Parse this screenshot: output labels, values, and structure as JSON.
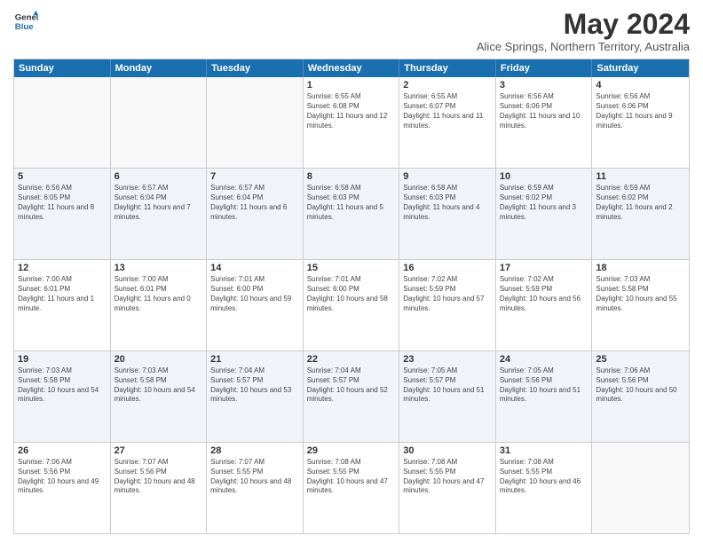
{
  "header": {
    "logo_line1": "General",
    "logo_line2": "Blue",
    "main_title": "May 2024",
    "sub_title": "Alice Springs, Northern Territory, Australia"
  },
  "days_of_week": [
    "Sunday",
    "Monday",
    "Tuesday",
    "Wednesday",
    "Thursday",
    "Friday",
    "Saturday"
  ],
  "weeks": [
    [
      {
        "day": "",
        "text": ""
      },
      {
        "day": "",
        "text": ""
      },
      {
        "day": "",
        "text": ""
      },
      {
        "day": "1",
        "text": "Sunrise: 6:55 AM\nSunset: 6:08 PM\nDaylight: 11 hours and 12 minutes."
      },
      {
        "day": "2",
        "text": "Sunrise: 6:55 AM\nSunset: 6:07 PM\nDaylight: 11 hours and 11 minutes."
      },
      {
        "day": "3",
        "text": "Sunrise: 6:56 AM\nSunset: 6:06 PM\nDaylight: 11 hours and 10 minutes."
      },
      {
        "day": "4",
        "text": "Sunrise: 6:56 AM\nSunset: 6:06 PM\nDaylight: 11 hours and 9 minutes."
      }
    ],
    [
      {
        "day": "5",
        "text": "Sunrise: 6:56 AM\nSunset: 6:05 PM\nDaylight: 11 hours and 8 minutes."
      },
      {
        "day": "6",
        "text": "Sunrise: 6:57 AM\nSunset: 6:04 PM\nDaylight: 11 hours and 7 minutes."
      },
      {
        "day": "7",
        "text": "Sunrise: 6:57 AM\nSunset: 6:04 PM\nDaylight: 11 hours and 6 minutes."
      },
      {
        "day": "8",
        "text": "Sunrise: 6:58 AM\nSunset: 6:03 PM\nDaylight: 11 hours and 5 minutes."
      },
      {
        "day": "9",
        "text": "Sunrise: 6:58 AM\nSunset: 6:03 PM\nDaylight: 11 hours and 4 minutes."
      },
      {
        "day": "10",
        "text": "Sunrise: 6:59 AM\nSunset: 6:02 PM\nDaylight: 11 hours and 3 minutes."
      },
      {
        "day": "11",
        "text": "Sunrise: 6:59 AM\nSunset: 6:02 PM\nDaylight: 11 hours and 2 minutes."
      }
    ],
    [
      {
        "day": "12",
        "text": "Sunrise: 7:00 AM\nSunset: 6:01 PM\nDaylight: 11 hours and 1 minute."
      },
      {
        "day": "13",
        "text": "Sunrise: 7:00 AM\nSunset: 6:01 PM\nDaylight: 11 hours and 0 minutes."
      },
      {
        "day": "14",
        "text": "Sunrise: 7:01 AM\nSunset: 6:00 PM\nDaylight: 10 hours and 59 minutes."
      },
      {
        "day": "15",
        "text": "Sunrise: 7:01 AM\nSunset: 6:00 PM\nDaylight: 10 hours and 58 minutes."
      },
      {
        "day": "16",
        "text": "Sunrise: 7:02 AM\nSunset: 5:59 PM\nDaylight: 10 hours and 57 minutes."
      },
      {
        "day": "17",
        "text": "Sunrise: 7:02 AM\nSunset: 5:59 PM\nDaylight: 10 hours and 56 minutes."
      },
      {
        "day": "18",
        "text": "Sunrise: 7:03 AM\nSunset: 5:58 PM\nDaylight: 10 hours and 55 minutes."
      }
    ],
    [
      {
        "day": "19",
        "text": "Sunrise: 7:03 AM\nSunset: 5:58 PM\nDaylight: 10 hours and 54 minutes."
      },
      {
        "day": "20",
        "text": "Sunrise: 7:03 AM\nSunset: 5:58 PM\nDaylight: 10 hours and 54 minutes."
      },
      {
        "day": "21",
        "text": "Sunrise: 7:04 AM\nSunset: 5:57 PM\nDaylight: 10 hours and 53 minutes."
      },
      {
        "day": "22",
        "text": "Sunrise: 7:04 AM\nSunset: 5:57 PM\nDaylight: 10 hours and 52 minutes."
      },
      {
        "day": "23",
        "text": "Sunrise: 7:05 AM\nSunset: 5:57 PM\nDaylight: 10 hours and 51 minutes."
      },
      {
        "day": "24",
        "text": "Sunrise: 7:05 AM\nSunset: 5:56 PM\nDaylight: 10 hours and 51 minutes."
      },
      {
        "day": "25",
        "text": "Sunrise: 7:06 AM\nSunset: 5:56 PM\nDaylight: 10 hours and 50 minutes."
      }
    ],
    [
      {
        "day": "26",
        "text": "Sunrise: 7:06 AM\nSunset: 5:56 PM\nDaylight: 10 hours and 49 minutes."
      },
      {
        "day": "27",
        "text": "Sunrise: 7:07 AM\nSunset: 5:56 PM\nDaylight: 10 hours and 48 minutes."
      },
      {
        "day": "28",
        "text": "Sunrise: 7:07 AM\nSunset: 5:55 PM\nDaylight: 10 hours and 48 minutes."
      },
      {
        "day": "29",
        "text": "Sunrise: 7:08 AM\nSunset: 5:55 PM\nDaylight: 10 hours and 47 minutes."
      },
      {
        "day": "30",
        "text": "Sunrise: 7:08 AM\nSunset: 5:55 PM\nDaylight: 10 hours and 47 minutes."
      },
      {
        "day": "31",
        "text": "Sunrise: 7:08 AM\nSunset: 5:55 PM\nDaylight: 10 hours and 46 minutes."
      },
      {
        "day": "",
        "text": ""
      }
    ]
  ]
}
